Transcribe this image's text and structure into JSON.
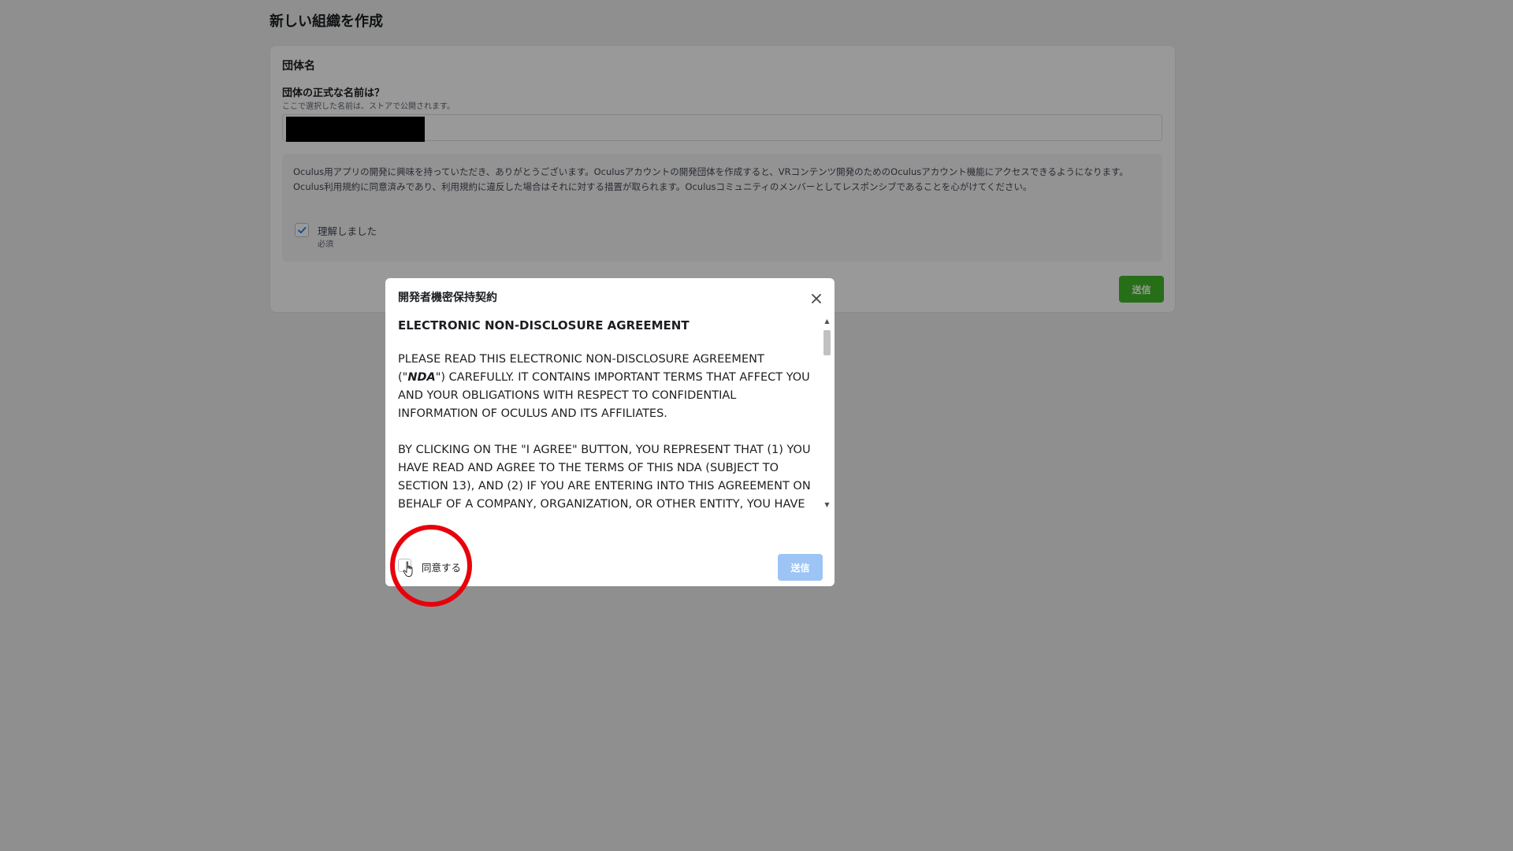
{
  "page": {
    "title": "新しい組織を作成"
  },
  "form": {
    "section_heading": "団体名",
    "name_label": "団体の正式な名前は？",
    "name_hint": "ここで選択した名前は、ストアで公開されます。",
    "name_value_redacted": true,
    "notice_text": "Oculus用アプリの開発に興味を持っていただき、ありがとうございます。Oculusアカウントの開発団体を作成すると、VRコンテンツ開発のためのOculusアカウント機能にアクセスできるようになります。Oculus利用規約に同意済みであり、利用規約に違反した場合はそれに対する措置が取られます。Oculusコミュニティのメンバーとしてレスポンシブであることを心がけてください。",
    "ack_label": "理解しました",
    "ack_required": "必須",
    "ack_checked": true,
    "submit_label": "送信"
  },
  "modal": {
    "title": "開発者機密保持契約",
    "body_heading": "ELECTRONIC NON-DISCLOSURE AGREEMENT",
    "para1_part1": "PLEASE READ THIS ELECTRONIC NON-DISCLOSURE AGREEMENT (\"",
    "para1_emph": "NDA",
    "para1_part2": "\") CAREFULLY. IT CONTAINS IMPORTANT TERMS THAT AFFECT YOU AND YOUR OBLIGATIONS WITH RESPECT TO CONFIDENTIAL INFORMATION OF OCULUS AND ITS AFFILIATES.",
    "para2": "BY CLICKING ON THE \"I AGREE\" BUTTON, YOU REPRESENT THAT (1) YOU HAVE READ AND AGREE TO THE TERMS OF THIS NDA (SUBJECT TO SECTION 13), AND (2) IF YOU ARE ENTERING INTO THIS AGREEMENT ON BEHALF OF A COMPANY, ORGANIZATION, OR OTHER ENTITY, YOU HAVE THE AUTHORITY TO BIND THE COMPANY, ORGANIZATION, OR OTHER ENTITY TO THESE TERMS.",
    "agree_label": "同意する",
    "agree_checked": false,
    "submit_label": "送信",
    "submit_disabled": true
  },
  "colors": {
    "primary_green": "#42b72a",
    "disabled_blue": "#9cc4f5",
    "highlight_red": "#e8000b"
  },
  "icons": {
    "close": "close-icon",
    "check": "checkmark-icon",
    "cursor": "hand-pointer-cursor-icon"
  }
}
